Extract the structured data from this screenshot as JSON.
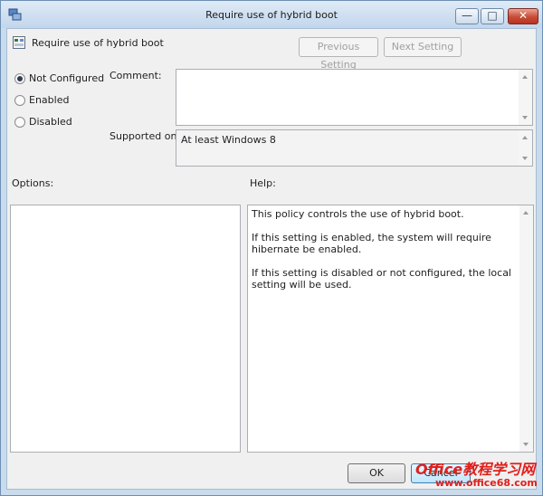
{
  "window": {
    "title": "Require use of hybrid boot",
    "controls": {
      "minimize": "—",
      "maximize": "□",
      "close": "✕"
    }
  },
  "header": {
    "policy_name": "Require use of hybrid boot",
    "previous_button": "Previous Setting",
    "next_button": "Next Setting"
  },
  "state": {
    "options": [
      {
        "label": "Not Configured",
        "checked": true
      },
      {
        "label": "Enabled",
        "checked": false
      },
      {
        "label": "Disabled",
        "checked": false
      }
    ]
  },
  "comment": {
    "label": "Comment:",
    "value": ""
  },
  "supported": {
    "label": "Supported on:",
    "value": "At least Windows 8"
  },
  "options_panel": {
    "label": "Options:"
  },
  "help_panel": {
    "label": "Help:",
    "paragraphs": [
      "This policy controls the use of hybrid boot.",
      "If this setting is enabled, the system will require hibernate be enabled.",
      "If this setting is disabled or not configured, the local setting will be used."
    ]
  },
  "footer": {
    "ok_button": "OK",
    "cancel_button": "Cancel"
  },
  "watermark": {
    "line1": "Office教程学习网",
    "line2": "www.office68.com"
  },
  "icons": {
    "app": "group-policy-icon",
    "policy": "policy-setting-icon"
  }
}
